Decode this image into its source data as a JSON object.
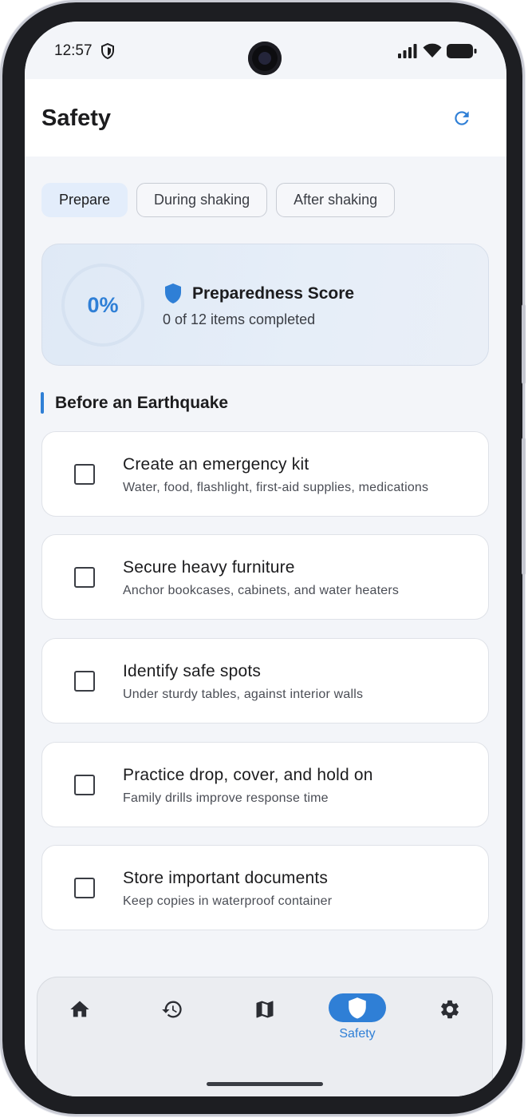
{
  "status_bar": {
    "time": "12:57",
    "icons": [
      "shield-status-icon",
      "signal-icon",
      "wifi-icon",
      "battery-icon"
    ]
  },
  "app_bar": {
    "title": "Safety",
    "action_icon": "refresh-icon"
  },
  "tabs": [
    {
      "label": "Prepare",
      "active": true
    },
    {
      "label": "During shaking",
      "active": false
    },
    {
      "label": "After shaking",
      "active": false
    }
  ],
  "score_card": {
    "percent_label": "0%",
    "percent": 0,
    "title": "Preparedness Score",
    "subtitle": "0 of 12 items completed"
  },
  "section": {
    "title": "Before an Earthquake"
  },
  "checklist": [
    {
      "title": "Create an emergency kit",
      "subtitle": "Water, food, flashlight, first-aid supplies, medications",
      "checked": false
    },
    {
      "title": "Secure heavy furniture",
      "subtitle": "Anchor bookcases, cabinets, and water heaters",
      "checked": false
    },
    {
      "title": "Identify safe spots",
      "subtitle": "Under sturdy tables, against interior walls",
      "checked": false
    },
    {
      "title": "Practice drop, cover, and hold on",
      "subtitle": "Family drills improve response time",
      "checked": false
    },
    {
      "title": "Store important documents",
      "subtitle": "Keep copies in waterproof container",
      "checked": false
    }
  ],
  "bottom_nav": {
    "items": [
      {
        "icon": "home-icon",
        "label": ""
      },
      {
        "icon": "history-icon",
        "label": ""
      },
      {
        "icon": "map-icon",
        "label": ""
      },
      {
        "icon": "shield-icon",
        "label": "Safety",
        "active": true
      },
      {
        "icon": "settings-icon",
        "label": ""
      }
    ]
  },
  "colors": {
    "accent": "#2f7fd6",
    "background": "#f3f5f9",
    "card": "#ffffff"
  }
}
